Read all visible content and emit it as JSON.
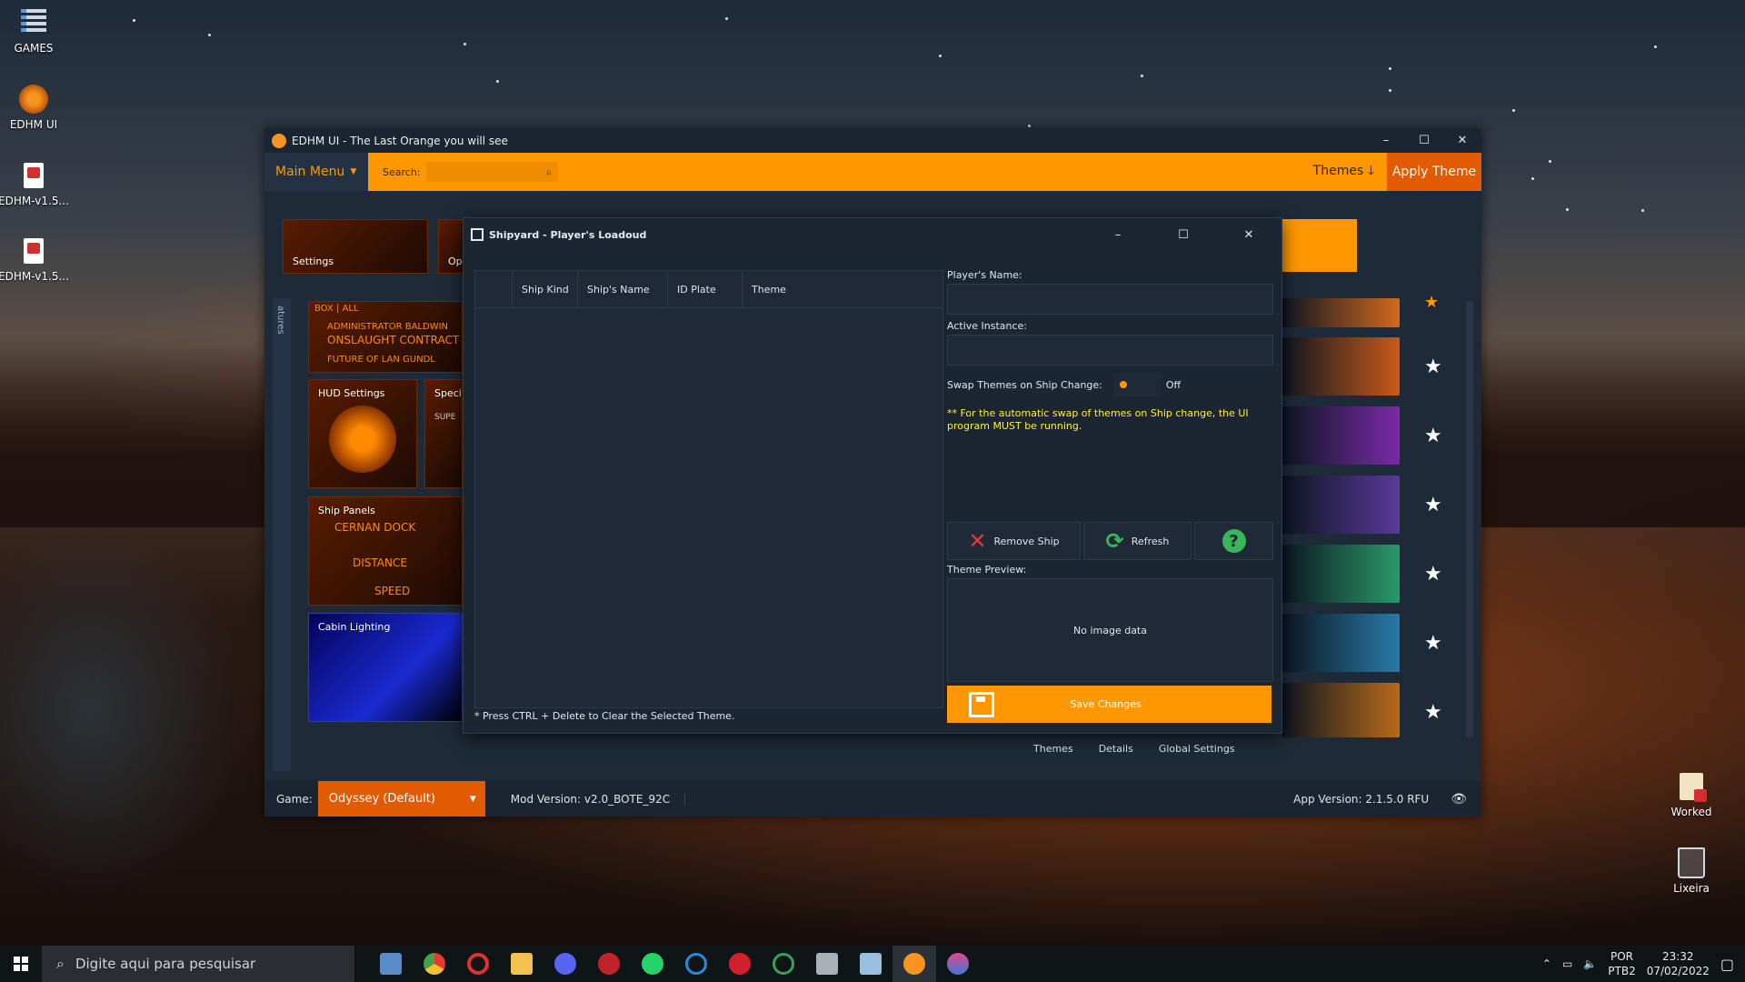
{
  "desktop": {
    "icons": [
      {
        "label": "GAMES",
        "icon": "games-folder-icon"
      },
      {
        "label": "EDHM UI",
        "icon": "edhm-app-icon"
      },
      {
        "label": "EDHM-v1.5...",
        "icon": "pdf-file-icon"
      },
      {
        "label": "EDHM-v1.5...",
        "icon": "pdf-file-icon"
      },
      {
        "label": "Worked",
        "icon": "document-icon"
      },
      {
        "label": "Lixeira",
        "icon": "recycle-bin-icon"
      }
    ]
  },
  "main_window": {
    "title": "EDHM UI - The Last Orange you will see",
    "minimize": "–",
    "maximize": "☐",
    "close": "✕",
    "main_menu_label": "Main Menu",
    "search_label": "Search:",
    "search_value": "",
    "themes_label": "Themes",
    "apply_theme_label": "Apply Theme",
    "tiles": {
      "settings": "Settings",
      "op": "Op",
      "hud_settings": "HUD Settings",
      "special": "Speci",
      "ship_panels": "Ship Panels",
      "cabin_lighting": "Cabin Lighting",
      "box_all": "BOX | ALL",
      "admin_line": "ADMINISTRATOR BALDWIN",
      "onslaught": "ONSLAUGHT CONTRACT",
      "future": "FUTURE OF LAN GUNDL",
      "super": "SUPE",
      "cernan": "CERNAN DOCK",
      "distance": "DISTANCE",
      "speed": "SPEED"
    },
    "side_text": "atures",
    "tabs": [
      "Themes",
      "Details",
      "Global Settings"
    ],
    "game_label": "Game:",
    "game_value": "Odyssey (Default)",
    "mod_version": "Mod Version: v2.0_BOTE_92C",
    "app_version": "App Version: 2.1.5.0 RFU"
  },
  "theme_thumbs": [
    {
      "color": "#d2691e"
    },
    {
      "color": "#c85a1a"
    },
    {
      "color": "#7a2aa8"
    },
    {
      "color": "#5a3a9a"
    },
    {
      "color": "#2a9a6a"
    },
    {
      "color": "#2a7aa8"
    },
    {
      "color": "#b86a1a"
    }
  ],
  "shipyard": {
    "title": "Shipyard - Player's Loadoud",
    "columns": [
      "",
      "Ship Kind",
      "Ship's Name",
      "ID Plate",
      "Theme"
    ],
    "note": "* Press CTRL + Delete to Clear the Selected Theme.",
    "players_name_label": "Player's Name:",
    "players_name_value": "",
    "active_instance_label": "Active Instance:",
    "active_instance_value": "",
    "swap_label": "Swap Themes on Ship Change:",
    "swap_state": "Off",
    "warning": "** For the automatic swap of themes on Ship change, the UI program MUST be running.",
    "remove_ship": "Remove Ship",
    "refresh": "Refresh",
    "theme_preview_label": "Theme Preview:",
    "no_image": "No image data",
    "save_changes": "Save Changes"
  },
  "taskbar": {
    "search_placeholder": "Digite aqui para pesquisar",
    "apps": [
      {
        "name": "file-explorer",
        "color": "#5a8ac8"
      },
      {
        "name": "chrome",
        "color": "#e8a400"
      },
      {
        "name": "opera",
        "color": "#e0322a"
      },
      {
        "name": "folder",
        "color": "#f2c14e"
      },
      {
        "name": "discord",
        "color": "#5865f2"
      },
      {
        "name": "app-red",
        "color": "#c0222a"
      },
      {
        "name": "whatsapp",
        "color": "#25d366"
      },
      {
        "name": "cortana",
        "color": "#2a8ad4"
      },
      {
        "name": "gt3",
        "color": "#d0202a"
      },
      {
        "name": "upwork",
        "color": "#37a05a"
      },
      {
        "name": "app-stack",
        "color": "#a8b0b8"
      },
      {
        "name": "app-blue",
        "color": "#9ac0e0"
      },
      {
        "name": "edhm",
        "color": "#f7931e"
      },
      {
        "name": "app-drop",
        "color": "#e2468a"
      }
    ],
    "language": "POR",
    "layout": "PTB2",
    "time": "23:32",
    "date": "07/02/2022"
  },
  "colors": {
    "accent": "#ff9800",
    "apply": "#e25b00",
    "warning": "#ffee33",
    "panel": "#1f2a38"
  }
}
